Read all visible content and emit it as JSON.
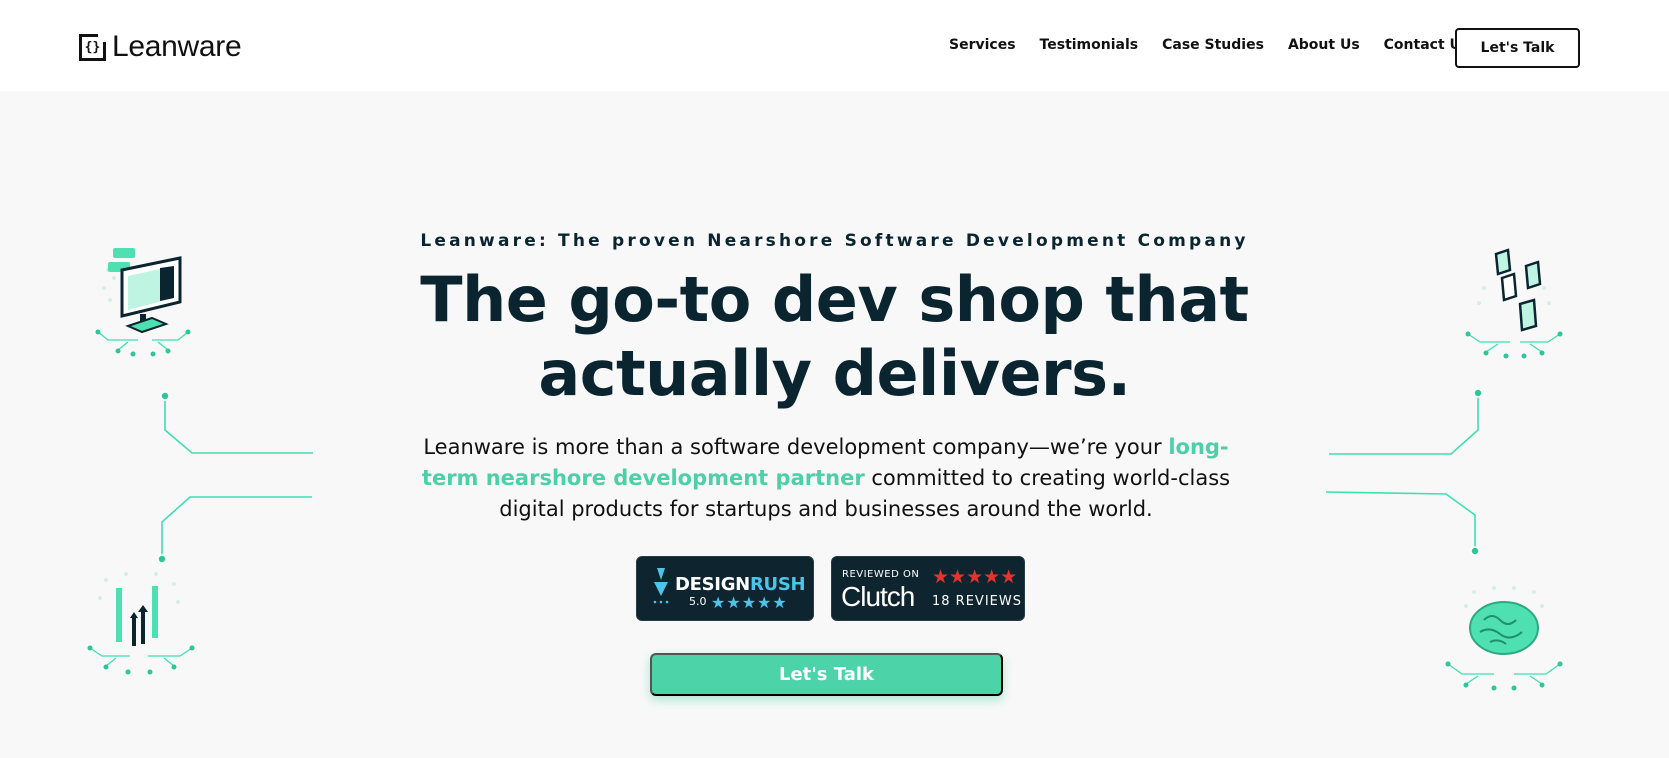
{
  "header": {
    "logo_text": "Leanware",
    "logo_mark": "{}",
    "nav": [
      "Services",
      "Testimonials",
      "Case Studies",
      "About Us",
      "Contact Us"
    ],
    "cta_label": "Let's Talk"
  },
  "hero": {
    "eyebrow": "Leanware: The proven Nearshore Software Development Company",
    "headline_line1": "The go-to dev shop that",
    "headline_line2": "actually delivers.",
    "subtext_before": "Leanware is more than a software development company—we’re your ",
    "subtext_accent": "long-term nearshore development partner",
    "subtext_after": " committed to creating world-class digital products for startups and businesses around the world.",
    "cta_label": "Let's Talk"
  },
  "badges": {
    "designrush": {
      "name_part1": "DESIGN",
      "name_part2": "RUSH",
      "rating": "5.0",
      "stars": "★★★★★"
    },
    "clutch": {
      "reviewed_on": "REVIEWED ON",
      "name": "Clutch",
      "stars": "★★★★★",
      "reviews": "18 REVIEWS"
    }
  },
  "colors": {
    "accent": "#4ecfa5",
    "dark": "#0b2530",
    "badge_bg": "#0e2530",
    "clutch_star": "#e5322d",
    "designrush_star": "#4dc4e8"
  },
  "icons": [
    "monitor-illustration",
    "puzzle-illustration",
    "growth-arrows-illustration",
    "brain-illustration"
  ]
}
